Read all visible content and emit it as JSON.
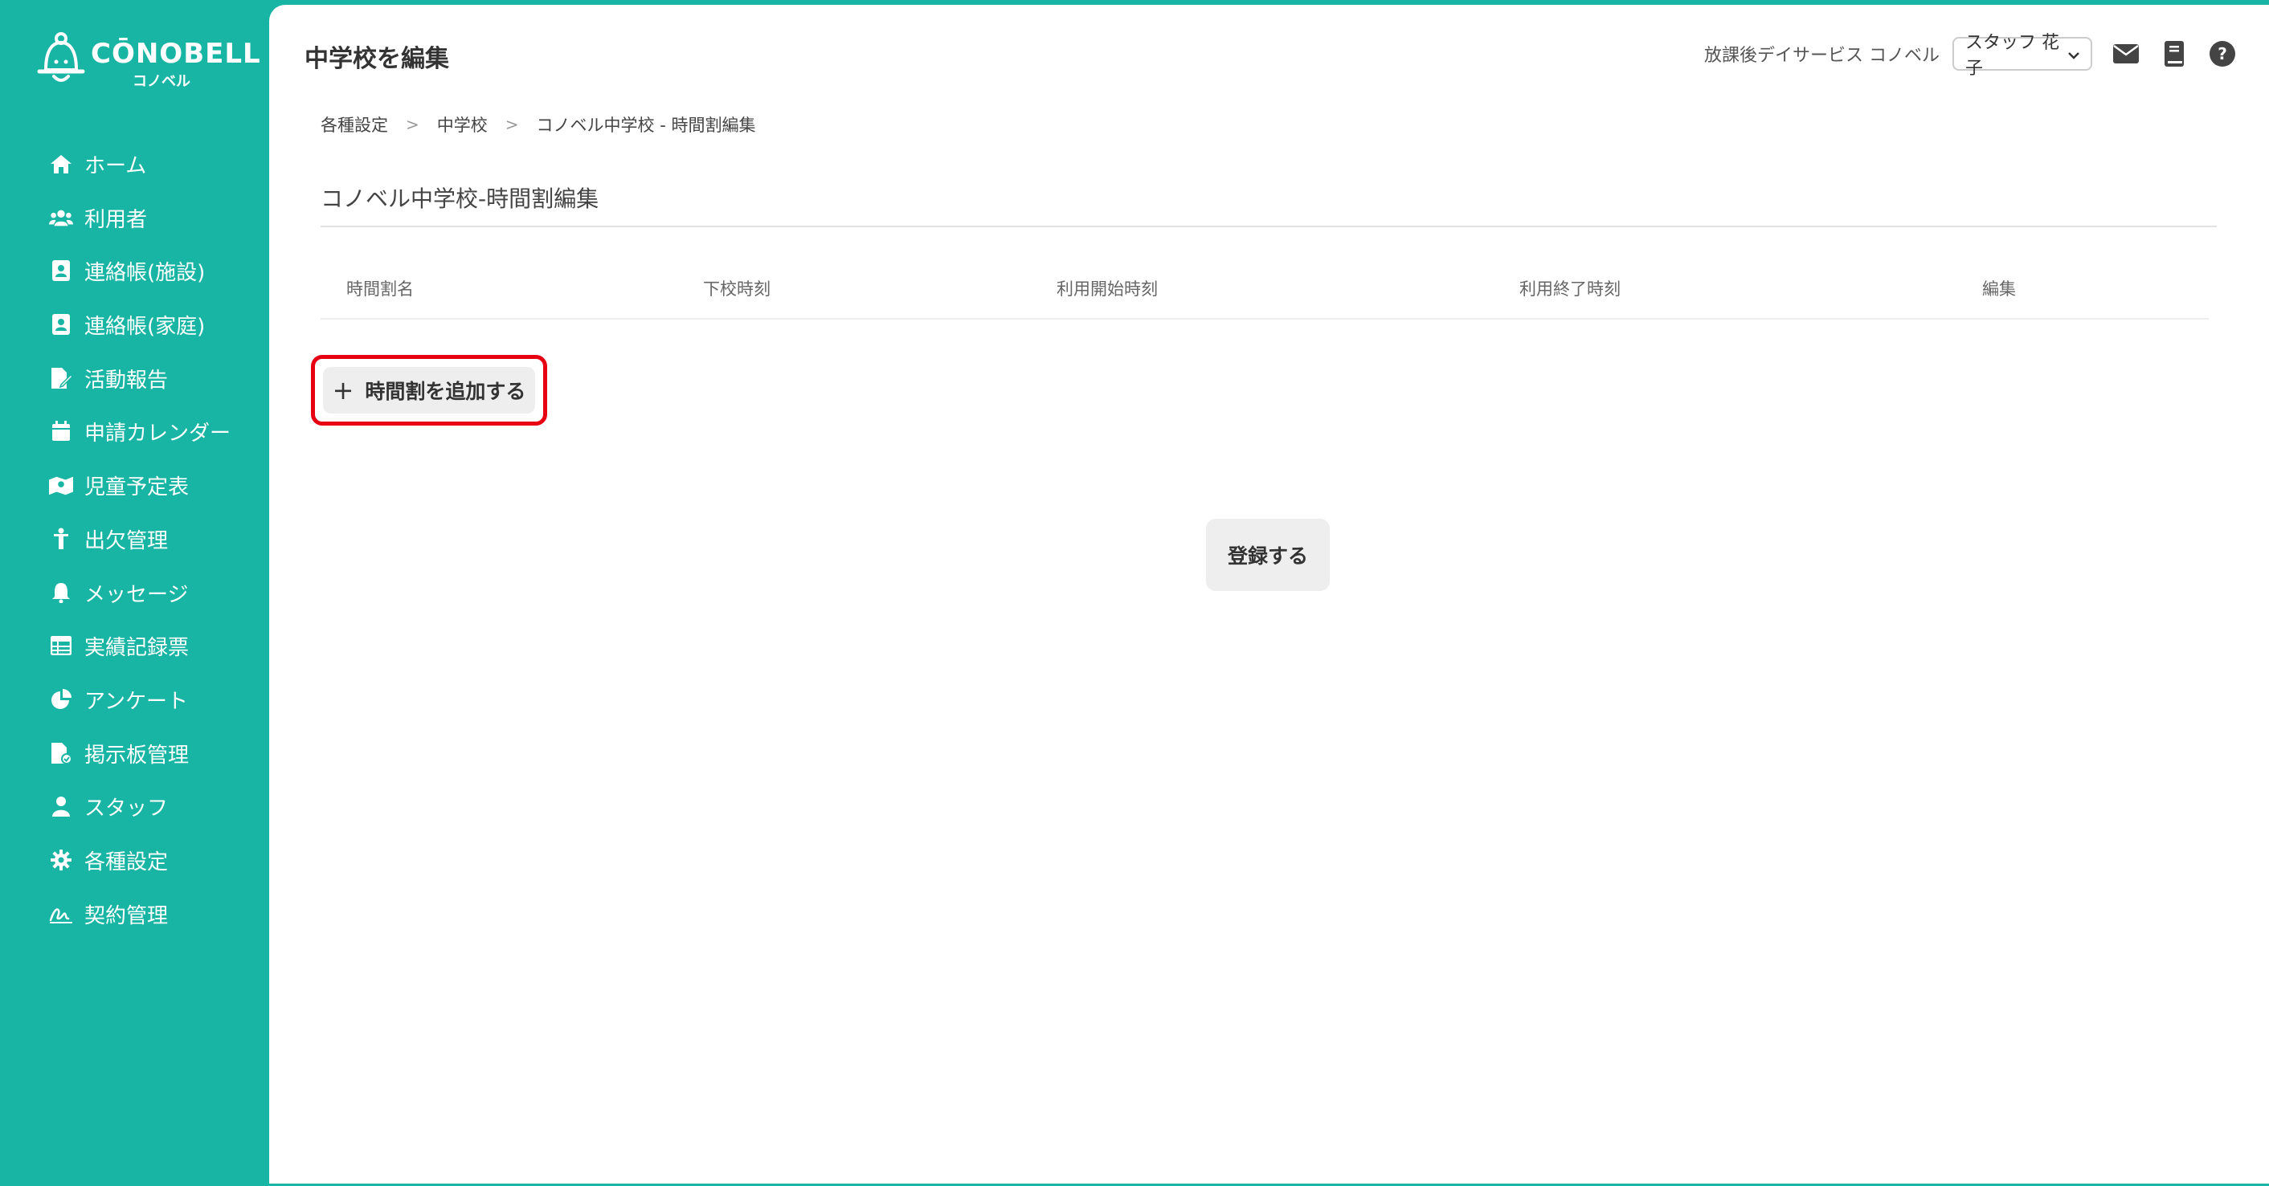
{
  "brand": {
    "name": "CŌNOBELL",
    "sub": "コノベル"
  },
  "sidebar": {
    "items": [
      {
        "label": "ホーム",
        "icon": "home-icon"
      },
      {
        "label": "利用者",
        "icon": "users-icon"
      },
      {
        "label": "連絡帳(施設)",
        "icon": "contact-book-icon"
      },
      {
        "label": "連絡帳(家庭)",
        "icon": "contact-book-icon"
      },
      {
        "label": "活動報告",
        "icon": "report-edit-icon"
      },
      {
        "label": "申請カレンダー",
        "icon": "calendar-icon"
      },
      {
        "label": "児童予定表",
        "icon": "schedule-map-icon"
      },
      {
        "label": "出欠管理",
        "icon": "child-icon"
      },
      {
        "label": "メッセージ",
        "icon": "bell-icon"
      },
      {
        "label": "実績記録票",
        "icon": "table-icon"
      },
      {
        "label": "アンケート",
        "icon": "pie-chart-icon"
      },
      {
        "label": "掲示板管理",
        "icon": "board-icon"
      },
      {
        "label": "スタッフ",
        "icon": "staff-icon"
      },
      {
        "label": "各種設定",
        "icon": "gear-icon"
      },
      {
        "label": "契約管理",
        "icon": "contract-icon"
      }
    ]
  },
  "header": {
    "title": "中学校を編集",
    "facility": "放課後デイサービス コノベル",
    "user": "スタッフ 花子"
  },
  "breadcrumb": [
    "各種設定",
    "中学校",
    "コノベル中学校 - 時間割編集"
  ],
  "section_title": "コノベル中学校-時間割編集",
  "table": {
    "columns": [
      "時間割名",
      "下校時刻",
      "利用開始時刻",
      "利用終了時刻",
      "編集"
    ]
  },
  "add_button": {
    "icon": "plus-icon",
    "label": "時間割を追加する"
  },
  "submit_button": "登録する",
  "colors": {
    "brand": "#19b5a4",
    "highlight": "#e60012",
    "button_bg": "#eeeeee"
  }
}
